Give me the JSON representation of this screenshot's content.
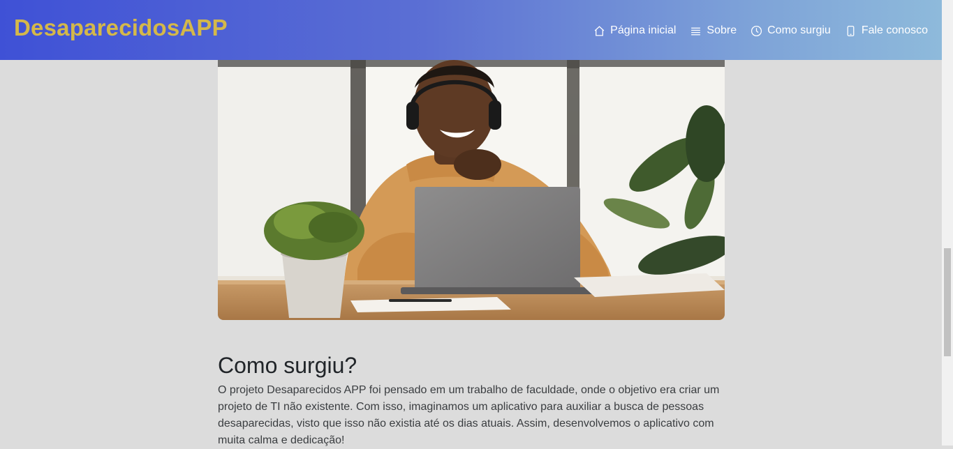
{
  "brand": "DesaparecidosAPP",
  "nav": [
    {
      "label": "Página inicial",
      "icon": "home-icon"
    },
    {
      "label": "Sobre",
      "icon": "list-icon"
    },
    {
      "label": "Como surgiu",
      "icon": "clock-icon"
    },
    {
      "label": "Fale conosco",
      "icon": "phone-icon"
    }
  ],
  "section": {
    "title": "Como surgiu?",
    "text": "O projeto Desaparecidos APP foi pensado em um trabalho de faculdade, onde o objetivo era criar um projeto de TI não existente. Com isso, imaginamos um aplicativo para auxiliar a busca de pessoas desaparecidas, visto que isso não existia até os dias atuais. Assim, desenvolvemos o aplicativo com muita calma e dedicação!"
  },
  "colors": {
    "brand": "#d4b84a",
    "nav_gradient_start": "#3f51d6",
    "nav_gradient_end": "#8ebadb",
    "background": "#dcdcdc"
  }
}
